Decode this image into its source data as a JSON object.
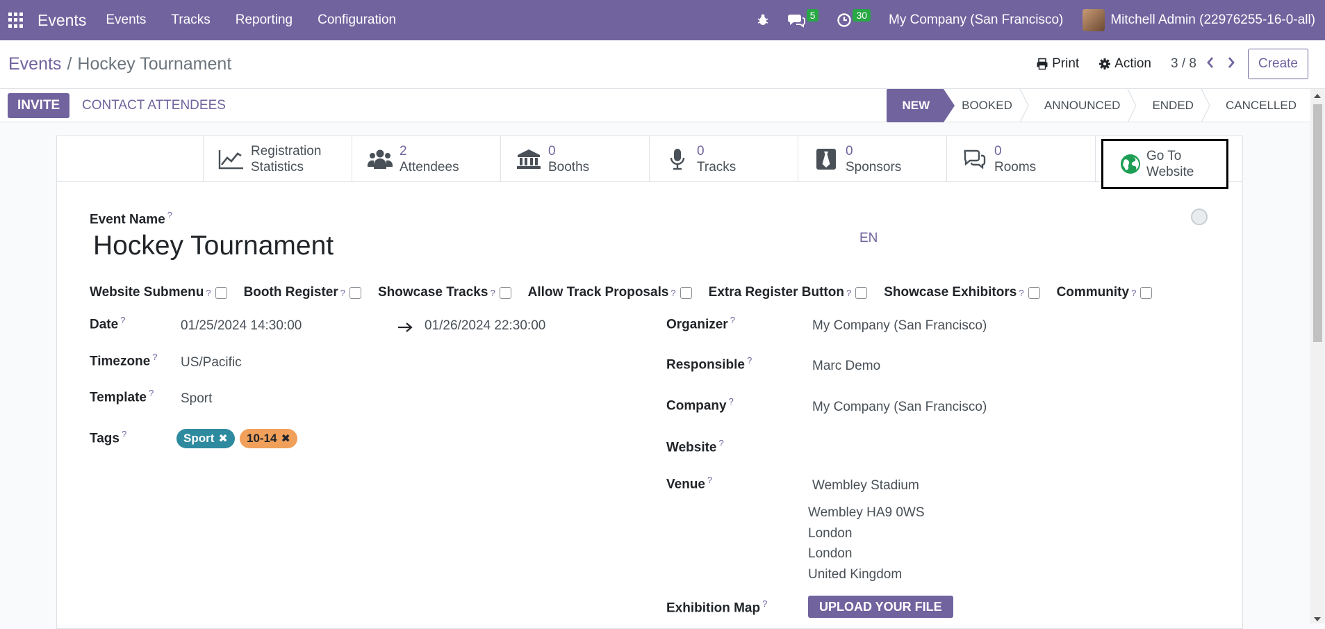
{
  "navbar": {
    "brand": "Events",
    "menu": [
      "Events",
      "Tracks",
      "Reporting",
      "Configuration"
    ],
    "messages_count": "5",
    "activities_count": "30",
    "company": "My Company (San Francisco)",
    "user": "Mitchell Admin (22976255-16-0-all)",
    "icons": [
      "apps-grid-icon",
      "bug-icon",
      "chat-icon",
      "clock-icon"
    ]
  },
  "control_panel": {
    "breadcrumb_parent": "Events",
    "breadcrumb_sep": "/",
    "breadcrumb_current": "Hockey Tournament",
    "print_label": "Print",
    "action_label": "Action",
    "pager": "3 / 8",
    "create_label": "Create"
  },
  "status_bar": {
    "invite_label": "INVITE",
    "contact_label": "CONTACT ATTENDEES",
    "stages": [
      "NEW",
      "BOOKED",
      "ANNOUNCED",
      "ENDED",
      "CANCELLED"
    ],
    "active_stage": "NEW"
  },
  "smart_buttons": {
    "registration_l1": "Registration",
    "registration_l2": "Statistics",
    "attendees_count": "2",
    "attendees_label": "Attendees",
    "booths_count": "0",
    "booths_label": "Booths",
    "tracks_count": "0",
    "tracks_label": "Tracks",
    "sponsors_count": "0",
    "sponsors_label": "Sponsors",
    "rooms_count": "0",
    "rooms_label": "Rooms",
    "website_l1": "Go To",
    "website_l2": "Website"
  },
  "form": {
    "event_name_label": "Event Name",
    "event_name": "Hockey Tournament",
    "lang": "EN",
    "help_mark": "?",
    "checkboxes": [
      "Website Submenu",
      "Booth Register",
      "Showcase Tracks",
      "Allow Track Proposals",
      "Extra Register Button",
      "Showcase Exhibitors",
      "Community"
    ],
    "date_label": "Date",
    "date_begin": "01/25/2024 14:30:00",
    "date_end": "01/26/2024 22:30:00",
    "timezone_label": "Timezone",
    "timezone": "US/Pacific",
    "template_label": "Template",
    "template": "Sport",
    "tags_label": "Tags",
    "tags": [
      {
        "label": "Sport",
        "color": "#2e8a9e"
      },
      {
        "label": "10-14",
        "color": "#f0a05a"
      }
    ],
    "organizer_label": "Organizer",
    "organizer": "My Company (San Francisco)",
    "responsible_label": "Responsible",
    "responsible": "Marc Demo",
    "company_label": "Company",
    "company": "My Company (San Francisco)",
    "website_label": "Website",
    "venue_label": "Venue",
    "venue_name": "Wembley Stadium",
    "venue_line1": "Wembley HA9 0WS",
    "venue_line2": "London",
    "venue_line3": "London",
    "venue_line4": "United Kingdom",
    "exhibition_map_label": "Exhibition Map",
    "upload_label": "UPLOAD YOUR FILE"
  },
  "colors": {
    "brand": "#71639e",
    "badge": "#28a745",
    "website_globe": "#1e9e55"
  }
}
